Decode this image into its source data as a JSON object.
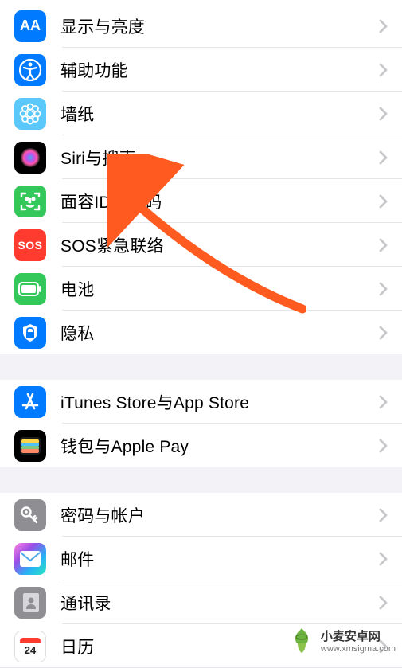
{
  "groups": [
    {
      "items": [
        {
          "key": "display",
          "label": "显示与亮度",
          "icon": "aa-icon",
          "iconBg": "bg-blue"
        },
        {
          "key": "accessibility",
          "label": "辅助功能",
          "icon": "accessibility-icon",
          "iconBg": "bg-blue"
        },
        {
          "key": "wallpaper",
          "label": "墙纸",
          "icon": "wallpaper-icon",
          "iconBg": "bg-cyan"
        },
        {
          "key": "siri",
          "label": "Siri与搜索",
          "icon": "siri-icon",
          "iconBg": "bg-black"
        },
        {
          "key": "faceid",
          "label": "面容ID与密码",
          "icon": "faceid-icon",
          "iconBg": "bg-green"
        },
        {
          "key": "sos",
          "label": "SOS紧急联络",
          "icon": "sos-icon",
          "iconBg": "bg-red"
        },
        {
          "key": "battery",
          "label": "电池",
          "icon": "battery-icon",
          "iconBg": "bg-green"
        },
        {
          "key": "privacy",
          "label": "隐私",
          "icon": "privacy-icon",
          "iconBg": "bg-blue"
        }
      ]
    },
    {
      "items": [
        {
          "key": "itunes",
          "label": "iTunes Store与App Store",
          "icon": "appstore-icon",
          "iconBg": "bg-blue"
        },
        {
          "key": "wallet",
          "label": "钱包与Apple Pay",
          "icon": "wallet-icon",
          "iconBg": "bg-black"
        }
      ]
    },
    {
      "items": [
        {
          "key": "passwords",
          "label": "密码与帐户",
          "icon": "key-icon",
          "iconBg": "bg-gray"
        },
        {
          "key": "mail",
          "label": "邮件",
          "icon": "mail-icon",
          "iconBg": "bg-grad"
        },
        {
          "key": "contacts",
          "label": "通讯录",
          "icon": "contacts-icon",
          "iconBg": "bg-gray"
        },
        {
          "key": "calendar",
          "label": "日历",
          "icon": "calendar-icon",
          "iconBg": "bg-white"
        }
      ]
    }
  ],
  "watermark": {
    "title": "小麦安卓网",
    "url": "www.xmsigma.com"
  },
  "annotation": {
    "type": "arrow",
    "target": "faceid"
  }
}
